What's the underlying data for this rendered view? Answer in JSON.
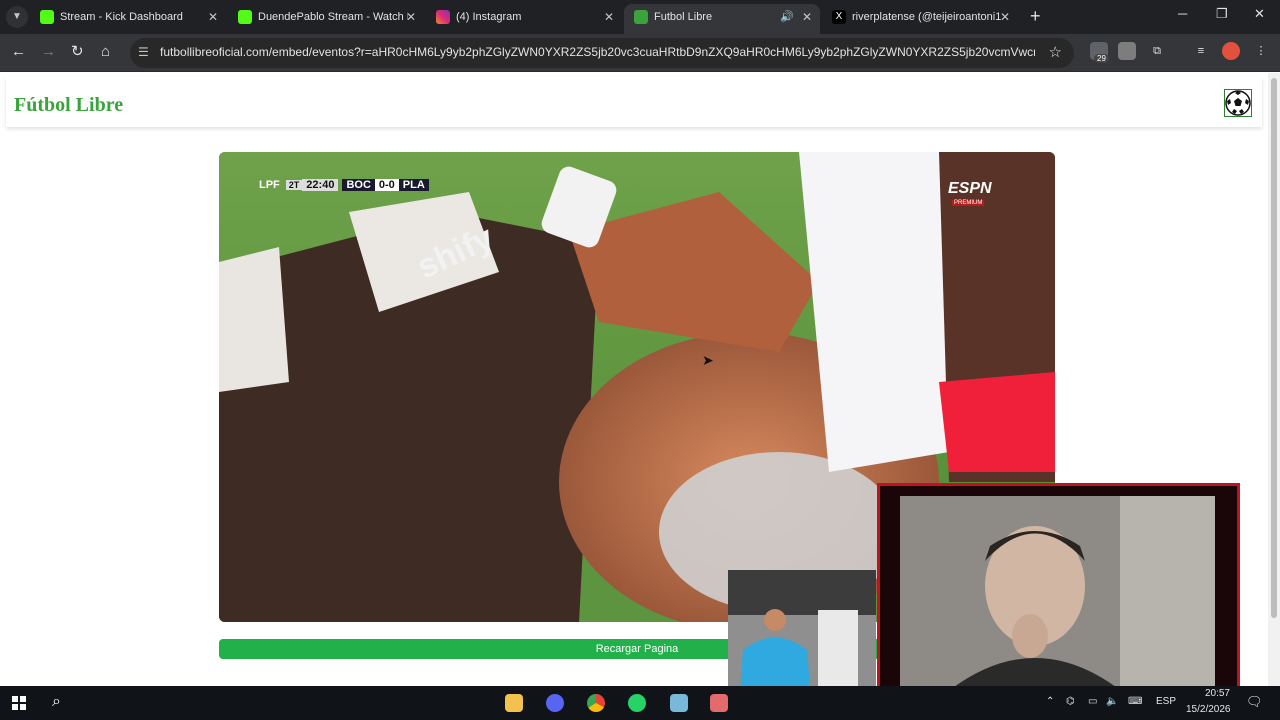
{
  "browser": {
    "tabs": [
      {
        "title": "Stream - Kick Dashboard",
        "favicon_color": "#53fc18",
        "active": false
      },
      {
        "title": "DuendePablo Stream - Watch L",
        "favicon_color": "#53fc18",
        "active": false
      },
      {
        "title": "(4) Instagram",
        "favicon_color": "#e1306c",
        "active": false
      },
      {
        "title": "Futbol Libre",
        "favicon_color": "#3aa43a",
        "active": true
      },
      {
        "title": "riverplatense (@teijeiroantoni1",
        "favicon_color": "#ffffff",
        "active": false
      }
    ],
    "new_tab_label": "+",
    "url": "futbollibreoficial.com/embed/eventos?r=aHR0cHM6Ly9yb2phZGlyZWN0YXR2ZS5jb20vc3cuaHRtbD9nZXQ9aHR0cHM6Ly9yb2phZGlyZWN0YXR2ZS5jb20vcmVwcm8vZX...",
    "extension_badge": "29"
  },
  "site": {
    "brand": "Fútbol Libre",
    "reload_button": "Recargar Pagina"
  },
  "video": {
    "league": "LPF",
    "period": "2T",
    "clock": "22:40",
    "home": "BOC",
    "score": "0-0",
    "away": "PLA",
    "broadcaster": "ESPN",
    "broadcaster_sub": "PREMIUM",
    "sponsor_text": "shify"
  },
  "taskbar": {
    "language": "ESP",
    "time": "20:57",
    "date": "15/2/2026"
  },
  "colors": {
    "accent_green": "#22b04a",
    "brand_green": "#3aa43a",
    "cam_frame_red": "#c1121f"
  }
}
